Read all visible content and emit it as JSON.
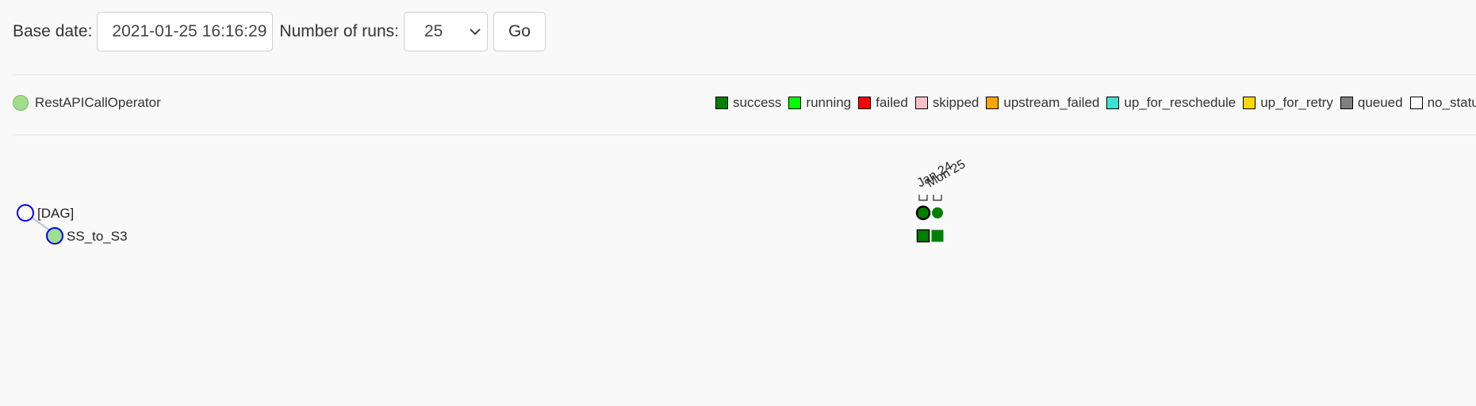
{
  "form": {
    "base_date_label": "Base date:",
    "base_date_value": "2021-01-25 16:16:29",
    "runs_label": "Number of runs:",
    "runs_value": "25",
    "go_label": "Go"
  },
  "operators": [
    {
      "label": "RestAPICallOperator",
      "color": "#a0dd8c"
    }
  ],
  "state_legend": [
    {
      "label": "success",
      "color": "#008000"
    },
    {
      "label": "running",
      "color": "#00ff00"
    },
    {
      "label": "failed",
      "color": "#ff0000"
    },
    {
      "label": "skipped",
      "color": "#ffc0cb"
    },
    {
      "label": "upstream_failed",
      "color": "#ffa500"
    },
    {
      "label": "up_for_reschedule",
      "color": "#40e0d0"
    },
    {
      "label": "up_for_retry",
      "color": "#ffd700"
    },
    {
      "label": "queued",
      "color": "#808080"
    },
    {
      "label": "no_status",
      "color": "#ffffff"
    }
  ],
  "tree": {
    "nodes": [
      {
        "label": "[DAG]",
        "fill": "#ffffff",
        "stroke": "#0000ff"
      },
      {
        "label": "SS_to_S3",
        "fill": "#a0dd8c",
        "stroke": "#0000ff"
      }
    ]
  },
  "runs": {
    "dates": [
      "Jan 24",
      "Mon 25"
    ],
    "dag_run_states": [
      "success",
      "success"
    ],
    "task_states": [
      "success",
      "success"
    ]
  }
}
